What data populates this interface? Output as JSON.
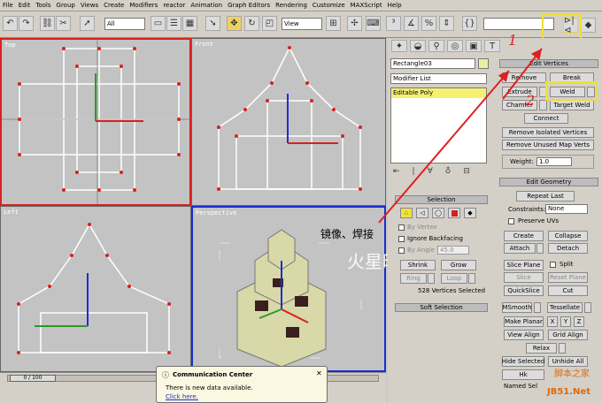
{
  "menu": [
    "File",
    "Edit",
    "Tools",
    "Group",
    "Views",
    "Create",
    "Modifiers",
    "reactor",
    "Animation",
    "Graph Editors",
    "Rendering",
    "Customize",
    "MAXScript",
    "Help"
  ],
  "toolbar": {
    "selection_filter": "All",
    "ref_coord": "View"
  },
  "viewports": [
    {
      "id": "top",
      "label": "Top"
    },
    {
      "id": "front",
      "label": "Front"
    },
    {
      "id": "left",
      "label": "Left"
    },
    {
      "id": "perspective",
      "label": "Perspective"
    }
  ],
  "overlay_text": {
    "caption": "镜像、焊接",
    "watermark": "火星时代",
    "num1": "1",
    "num2": "2"
  },
  "panel": {
    "object_name": "Rectangle03",
    "modifier_list": "Modifier List",
    "stack_item": "Editable Poly",
    "edit_vertices": {
      "title": "Edit Vertices",
      "remove": "Remove",
      "break": "Break",
      "extrude": "Extrude",
      "weld": "Weld",
      "chamfer": "Chamfer",
      "target_weld": "Target Weld",
      "connect": "Connect",
      "remove_isolated": "Remove Isolated Vertices",
      "remove_unused": "Remove Unused Map Verts",
      "weight_label": "Weight:",
      "weight_value": "1.0"
    },
    "edit_geometry": {
      "title": "Edit Geometry",
      "repeat_last": "Repeat Last",
      "constraints_label": "Constraints:",
      "constraints_value": "None",
      "preserve_uvs": "Preserve UVs",
      "create": "Create",
      "collapse": "Collapse",
      "attach": "Attach",
      "detach": "Detach",
      "slice_plane": "Slice Plane",
      "split": "Split",
      "slice": "Slice",
      "reset_plane": "Reset Plane",
      "quickslice": "QuickSlice",
      "cut": "Cut",
      "msmooth": "MSmooth",
      "tessellate": "Tessellate",
      "make_planar": "Make Planar",
      "x": "X",
      "y": "Y",
      "z": "Z",
      "view_align": "View Align",
      "grid_align": "Grid Align",
      "relax": "Relax",
      "hide_selected": "Hide Selected",
      "unhide_all": "Unhide All",
      "hide_unselected": "Hk",
      "named_sel": "Named Sel"
    },
    "selection": {
      "title": "Selection",
      "by_vertex": "By Vertex",
      "ignore_backfacing": "Ignore Backfacing",
      "by_angle": "By Angle",
      "angle_value": "45.0",
      "shrink": "Shrink",
      "grow": "Grow",
      "ring": "Ring",
      "loop": "Loop",
      "status": "528 Vertices Selected"
    },
    "soft_selection": "Soft Selection"
  },
  "timeline": {
    "frame": "0 / 100"
  },
  "comm": {
    "title": "Communication Center",
    "body": "There is new data available.",
    "link": "Click here."
  },
  "site_watermark": {
    "top": "脚本之家",
    "bottom": "JB51.Net"
  }
}
